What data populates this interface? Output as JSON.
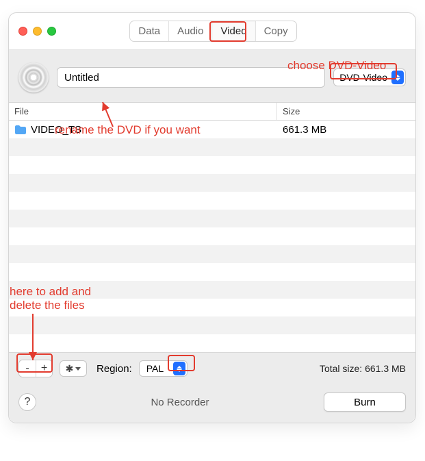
{
  "tabs": [
    {
      "label": "Data"
    },
    {
      "label": "Audio"
    },
    {
      "label": "Video"
    },
    {
      "label": "Copy"
    }
  ],
  "active_tab_index": 2,
  "disc_name": "Untitled",
  "disc_type": "DVD-Video",
  "columns": {
    "file": "File",
    "size": "Size"
  },
  "files": [
    {
      "name": "VIDEO_TS",
      "size": "661.3 MB",
      "icon": "folder"
    }
  ],
  "region_label": "Region:",
  "region_value": "PAL",
  "total_size_label": "Total size: 661.3 MB",
  "status_text": "No Recorder",
  "burn_label": "Burn",
  "help_label": "?",
  "minus_label": "-",
  "plus_label": "+",
  "annotations": {
    "choose": "choose DVD-Video",
    "rename": "rename the DVD if you want",
    "addremove": "here to add and\ndelete the files"
  },
  "colors": {
    "annotation": "#e23b2e",
    "accent": "#1f6fff"
  }
}
